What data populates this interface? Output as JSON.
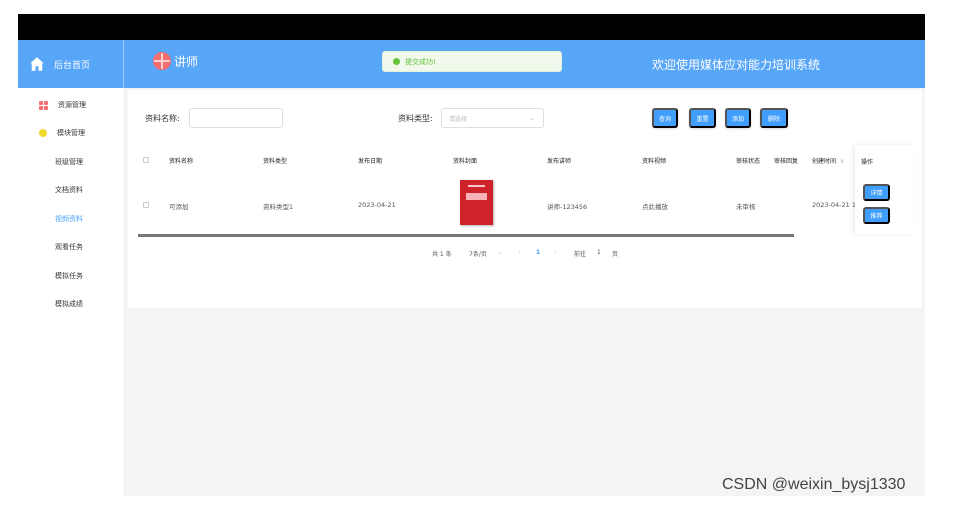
{
  "header": {
    "home_label": "后台首页",
    "role_label": "讲师",
    "toast_text": "提交成功!",
    "system_title": "欢迎使用媒体应对能力培训系统"
  },
  "sidebar": {
    "items": [
      {
        "label": "资源管理"
      },
      {
        "label": "模块管理"
      },
      {
        "label": "班级管理"
      },
      {
        "label": "文档资料"
      },
      {
        "label": "视频资料"
      },
      {
        "label": "观看任务"
      },
      {
        "label": "模拟任务"
      },
      {
        "label": "模拟成绩"
      }
    ]
  },
  "search": {
    "name_label": "资料名称:",
    "name_placeholder": "",
    "type_label": "资料类型:",
    "type_placeholder": "请选择",
    "buttons": {
      "query": "查询",
      "reset": "重置",
      "add": "添加",
      "delete": "删除"
    }
  },
  "table": {
    "headers": {
      "name": "资料名称",
      "type": "资料类型",
      "date": "发布日期",
      "cover": "资料封面",
      "teacher": "发布讲师",
      "video": "资料视频",
      "review_status": "审核状态",
      "review_reply": "审核回复",
      "created_time": "创建时间",
      "operation": "操作"
    },
    "rows": [
      {
        "name": "可添加",
        "type": "资料类型1",
        "date": "2023-04-21",
        "teacher": "讲师-123456",
        "video": "点此播放",
        "review_status": "未审核",
        "created_time": "2023-04-21 1"
      }
    ],
    "actions": {
      "detail": "详情",
      "recommend": "推荐"
    }
  },
  "pagination": {
    "total": "共 1 条",
    "page_size": "7条/页",
    "current_page": "1",
    "goto_label": "前往",
    "goto_value": "1",
    "page_unit": "页"
  },
  "watermark": "CSDN @weixin_bysj1330",
  "colors": {
    "header_blue": "#58a6f8",
    "button_blue": "#409eff",
    "success_green": "#67c23a"
  }
}
